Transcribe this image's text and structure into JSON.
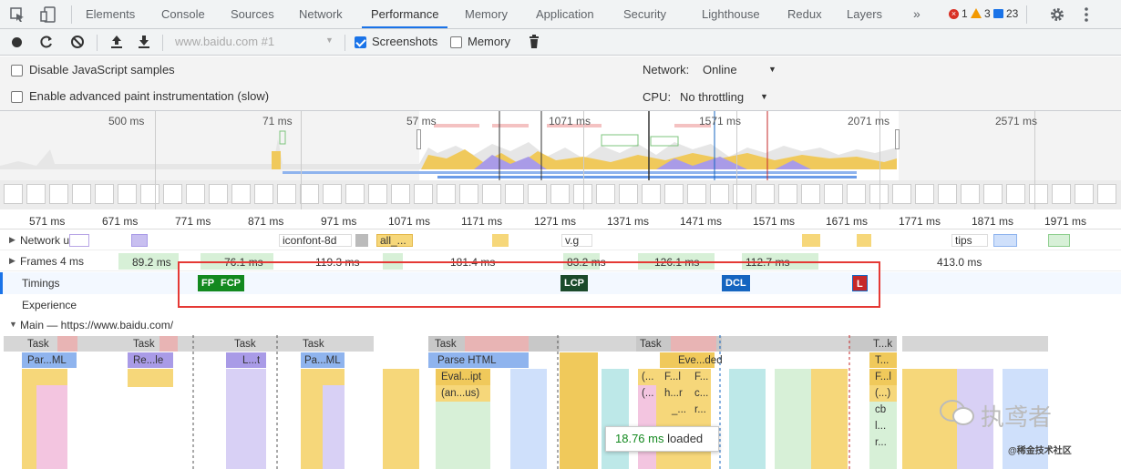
{
  "tabs": {
    "items": [
      "Elements",
      "Console",
      "Sources",
      "Network",
      "Performance",
      "Memory",
      "Application",
      "Security",
      "Lighthouse",
      "Redux",
      "Layers"
    ],
    "more": "»",
    "errors": "1",
    "warnings": "3",
    "messages": "23"
  },
  "toolbar": {
    "profile_select": "www.baidu.com #1",
    "screenshots_label": "Screenshots",
    "memory_label": "Memory"
  },
  "settings": {
    "disable_js_samples": "Disable JavaScript samples",
    "advanced_paint": "Enable advanced paint instrumentation (slow)",
    "network_label": "Network:",
    "network_value": "Online",
    "cpu_label": "CPU:",
    "cpu_value": "No throttling"
  },
  "overview": {
    "ticks": [
      "500 ms",
      "71 ms",
      "57 ms",
      "1071 ms",
      "1571 ms",
      "2071 ms",
      "2571 ms"
    ]
  },
  "ruler": {
    "ticks": [
      "571 ms",
      "671 ms",
      "771 ms",
      "871 ms",
      "971 ms",
      "1071 ms",
      "1171 ms",
      "1271 ms",
      "1371 ms",
      "1471 ms",
      "1571 ms",
      "1671 ms",
      "1771 ms",
      "1871 ms",
      "1971 ms"
    ]
  },
  "tracks": {
    "network_label": "Network u...",
    "network_items": [
      "iconfont-8d",
      "all_...",
      "v.g",
      "tips"
    ],
    "frames_label": "Frames 4 ms",
    "frames_values": [
      "89.2 ms",
      "76.1 ms",
      "119.3 ms",
      "181.4 ms",
      "83.2 ms",
      "126.1 ms",
      "112.7 ms",
      "413.0 ms"
    ],
    "timings_label": "Timings",
    "timings_markers": [
      "FP",
      "FCP",
      "LCP",
      "DCL",
      "L"
    ],
    "experience_label": "Experience",
    "main_label": "Main — https://www.baidu.com/"
  },
  "main": {
    "tasks": [
      "Task",
      "Task",
      "Task",
      "Task",
      "Task",
      "Task",
      "T...k"
    ],
    "row2": [
      "Par...ML",
      "Re...le",
      "L...t",
      "Pa...ML",
      "Parse HTML",
      "Eve...ded",
      "T..."
    ],
    "row3": [
      "Eval...ipt",
      "(...",
      "F...l",
      "F...",
      "F...l"
    ],
    "row4": [
      "(an...us)",
      "(...",
      "h...r",
      "c...",
      "(...)"
    ],
    "row5": [
      "_...",
      "r...",
      "cb"
    ],
    "row6": [
      "l..."
    ],
    "row7": [
      "r..."
    ]
  },
  "tooltip": {
    "time": "18.76 ms",
    "text": "loaded"
  },
  "watermark": {
    "text": "执鸢者",
    "brand": "@稀金技术社区"
  },
  "colors": {
    "accent": "#1a73e8",
    "task_gray": "#c8c8c8",
    "script_yellow": "#f0c95b",
    "parse_blue": "#8fb4ee",
    "layout_purple": "#a99be7",
    "fp_green": "#13891f",
    "lcp_dark": "#1b4a2b",
    "dcl_blue": "#1565c0",
    "load_red": "#c62828"
  }
}
